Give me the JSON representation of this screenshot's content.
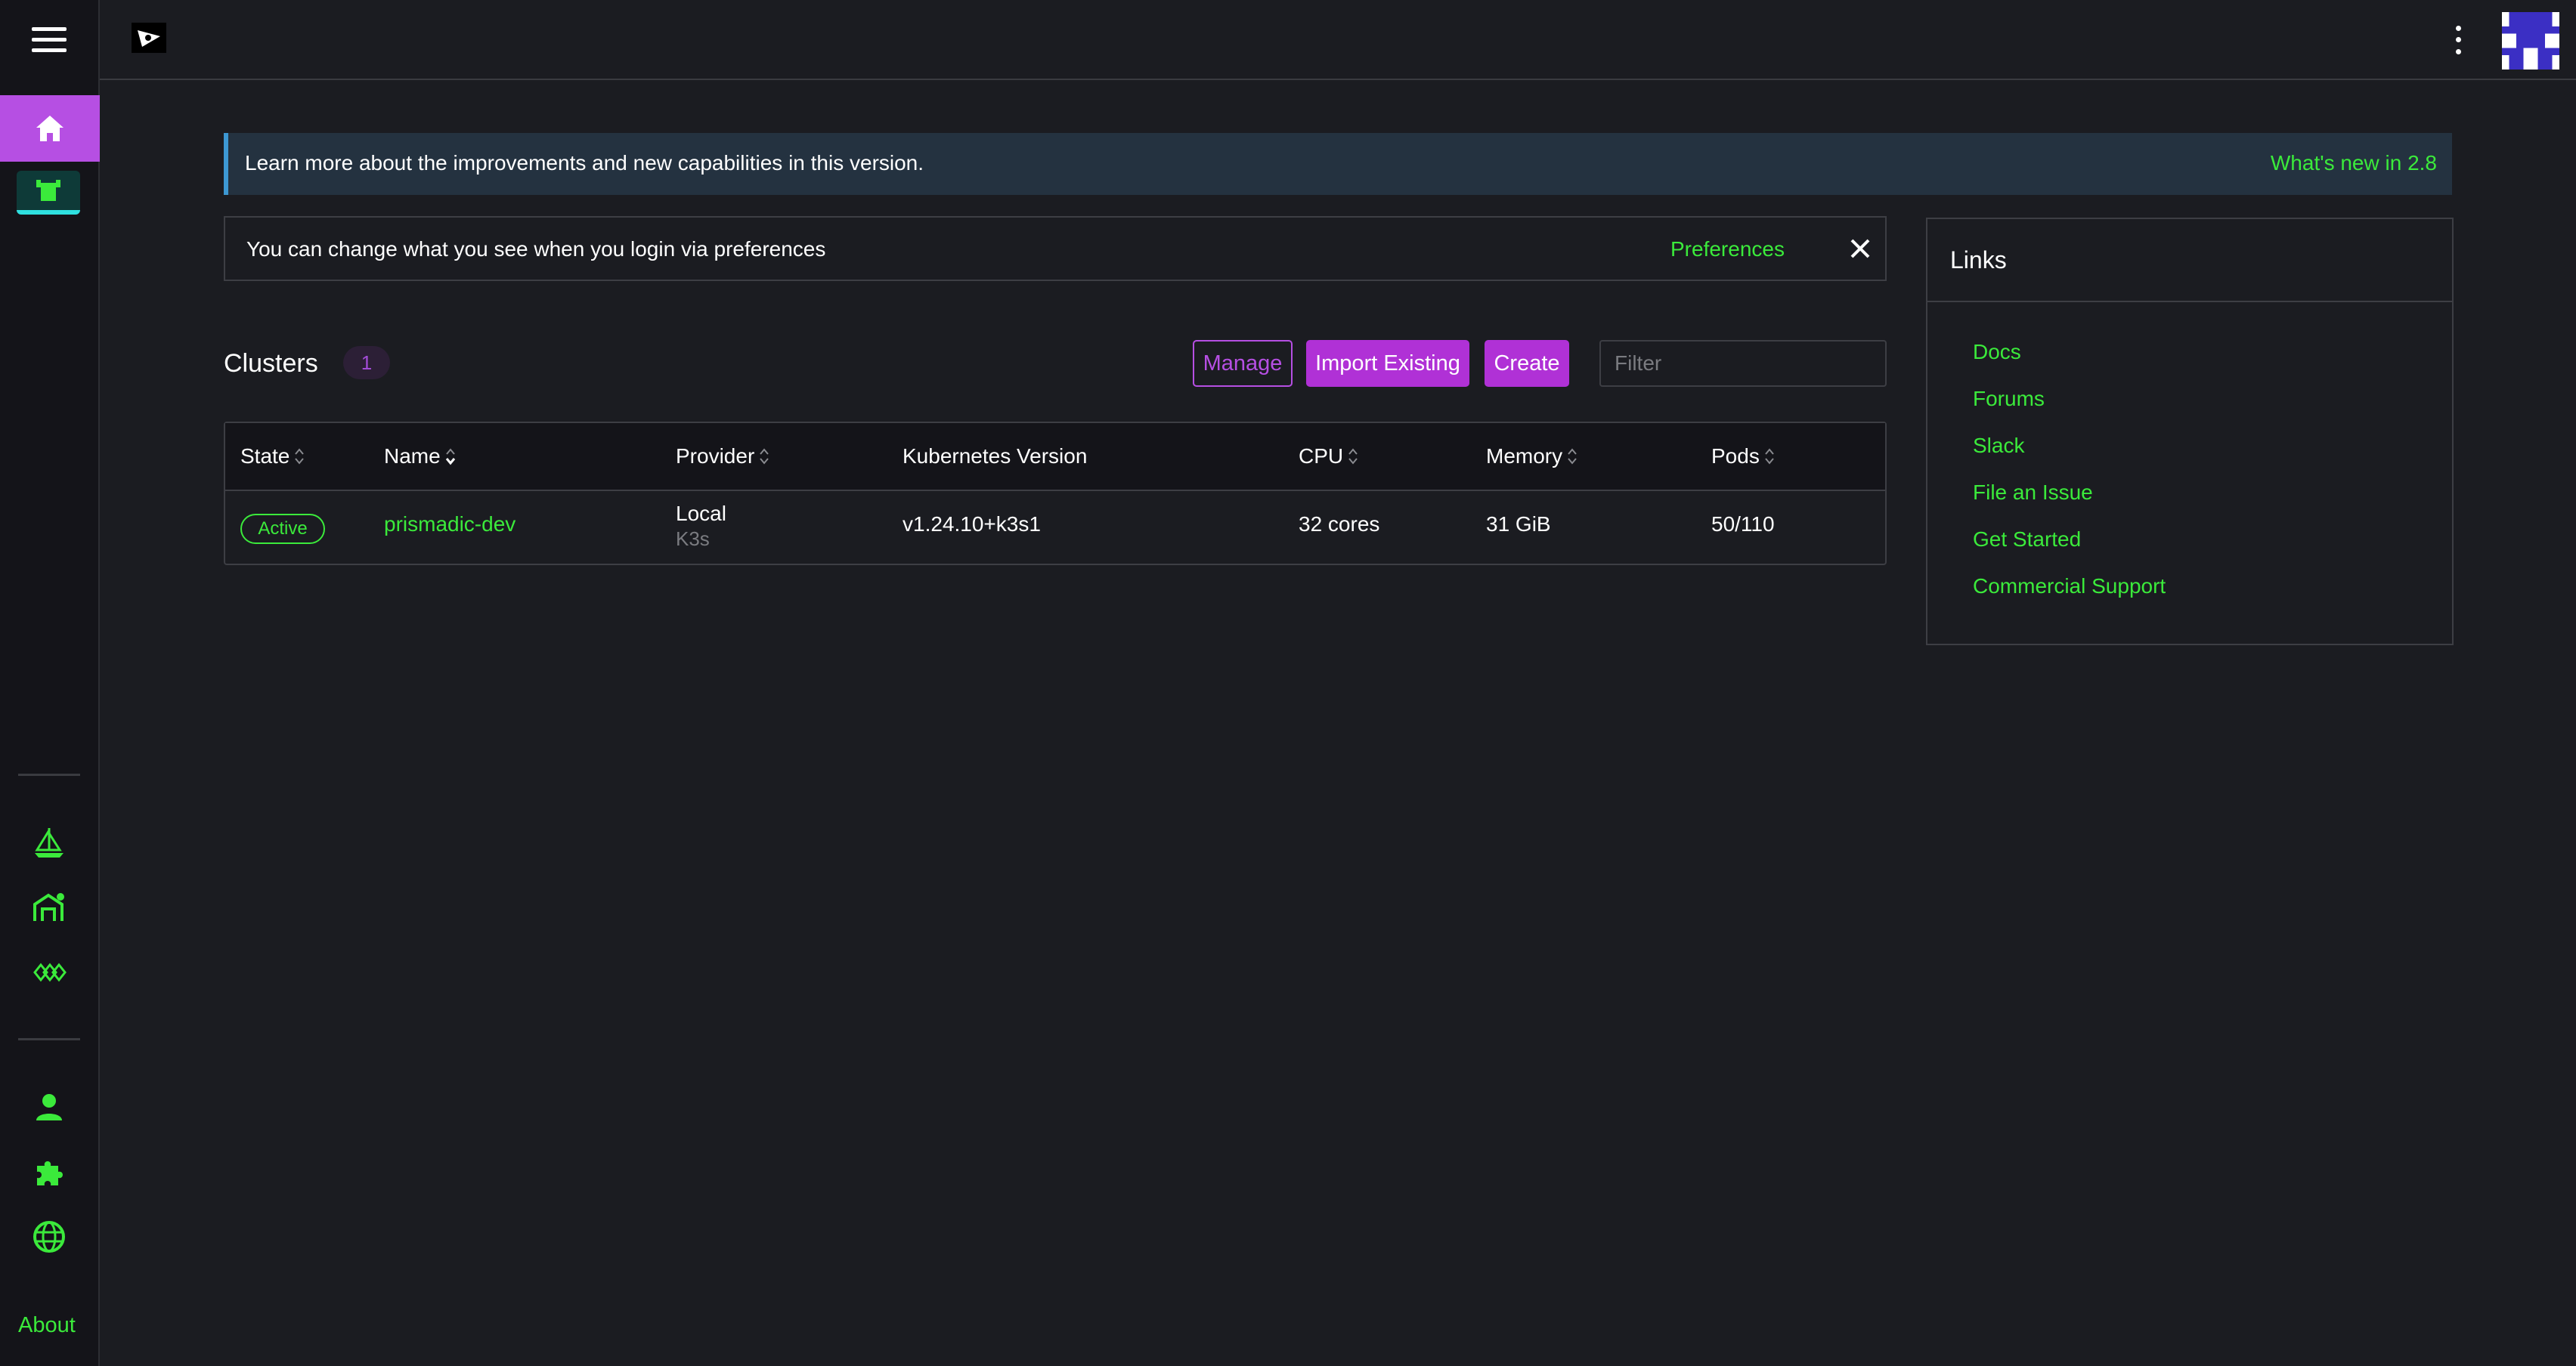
{
  "sidebar": {
    "about_label": "About",
    "icons": [
      "menu-icon",
      "home-icon",
      "cluster-icon",
      "helm-icon",
      "continuous-delivery-icon",
      "virtualization-icon",
      "user-icon",
      "extensions-icon",
      "globe-icon"
    ]
  },
  "banner": {
    "text": "Learn more about the improvements and new capabilities in this version.",
    "link": "What's new in 2.8"
  },
  "preferences_notice": {
    "text": "You can change what you see when you login via preferences",
    "link": "Preferences"
  },
  "clusters": {
    "title": "Clusters",
    "count": "1",
    "manage_label": "Manage",
    "import_label": "Import Existing",
    "create_label": "Create",
    "filter_placeholder": "Filter",
    "columns": [
      "State",
      "Name",
      "Provider",
      "Kubernetes Version",
      "CPU",
      "Memory",
      "Pods"
    ],
    "rows": [
      {
        "state": "Active",
        "name": "prismadic-dev",
        "provider": "Local",
        "provider_sub": "K3s",
        "version": "v1.24.10+k3s1",
        "cpu": "32 cores",
        "memory": "31 GiB",
        "pods": "50/110"
      }
    ]
  },
  "links": {
    "title": "Links",
    "items": [
      "Docs",
      "Forums",
      "Slack",
      "File an Issue",
      "Get Started",
      "Commercial Support"
    ]
  },
  "colors": {
    "accent_green": "#3bea3b",
    "accent_purple": "#b64fe3",
    "info_blue": "#3d98d3",
    "background": "#1b1c21"
  }
}
